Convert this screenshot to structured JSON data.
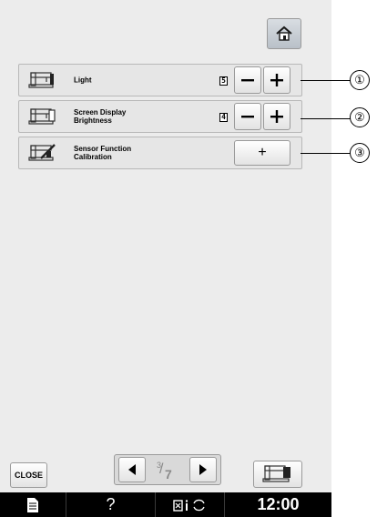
{
  "header": {
    "home_icon": "home-icon"
  },
  "settings": [
    {
      "label_lines": [
        "Light"
      ],
      "value": "5",
      "decrease": "−",
      "increase": "+",
      "callout": "①"
    },
    {
      "label_lines": [
        "Screen Display",
        "Brightness"
      ],
      "value": "4",
      "decrease": "−",
      "increase": "+",
      "callout": "②"
    },
    {
      "label_lines": [
        "Sensor Function",
        "Calibration"
      ],
      "action": "+",
      "callout": "③"
    }
  ],
  "footer": {
    "close_label": "CLOSE",
    "page_current": "3",
    "page_slash": "/",
    "page_total": "7"
  },
  "status_bar": {
    "help": "?",
    "time": "12:00"
  }
}
